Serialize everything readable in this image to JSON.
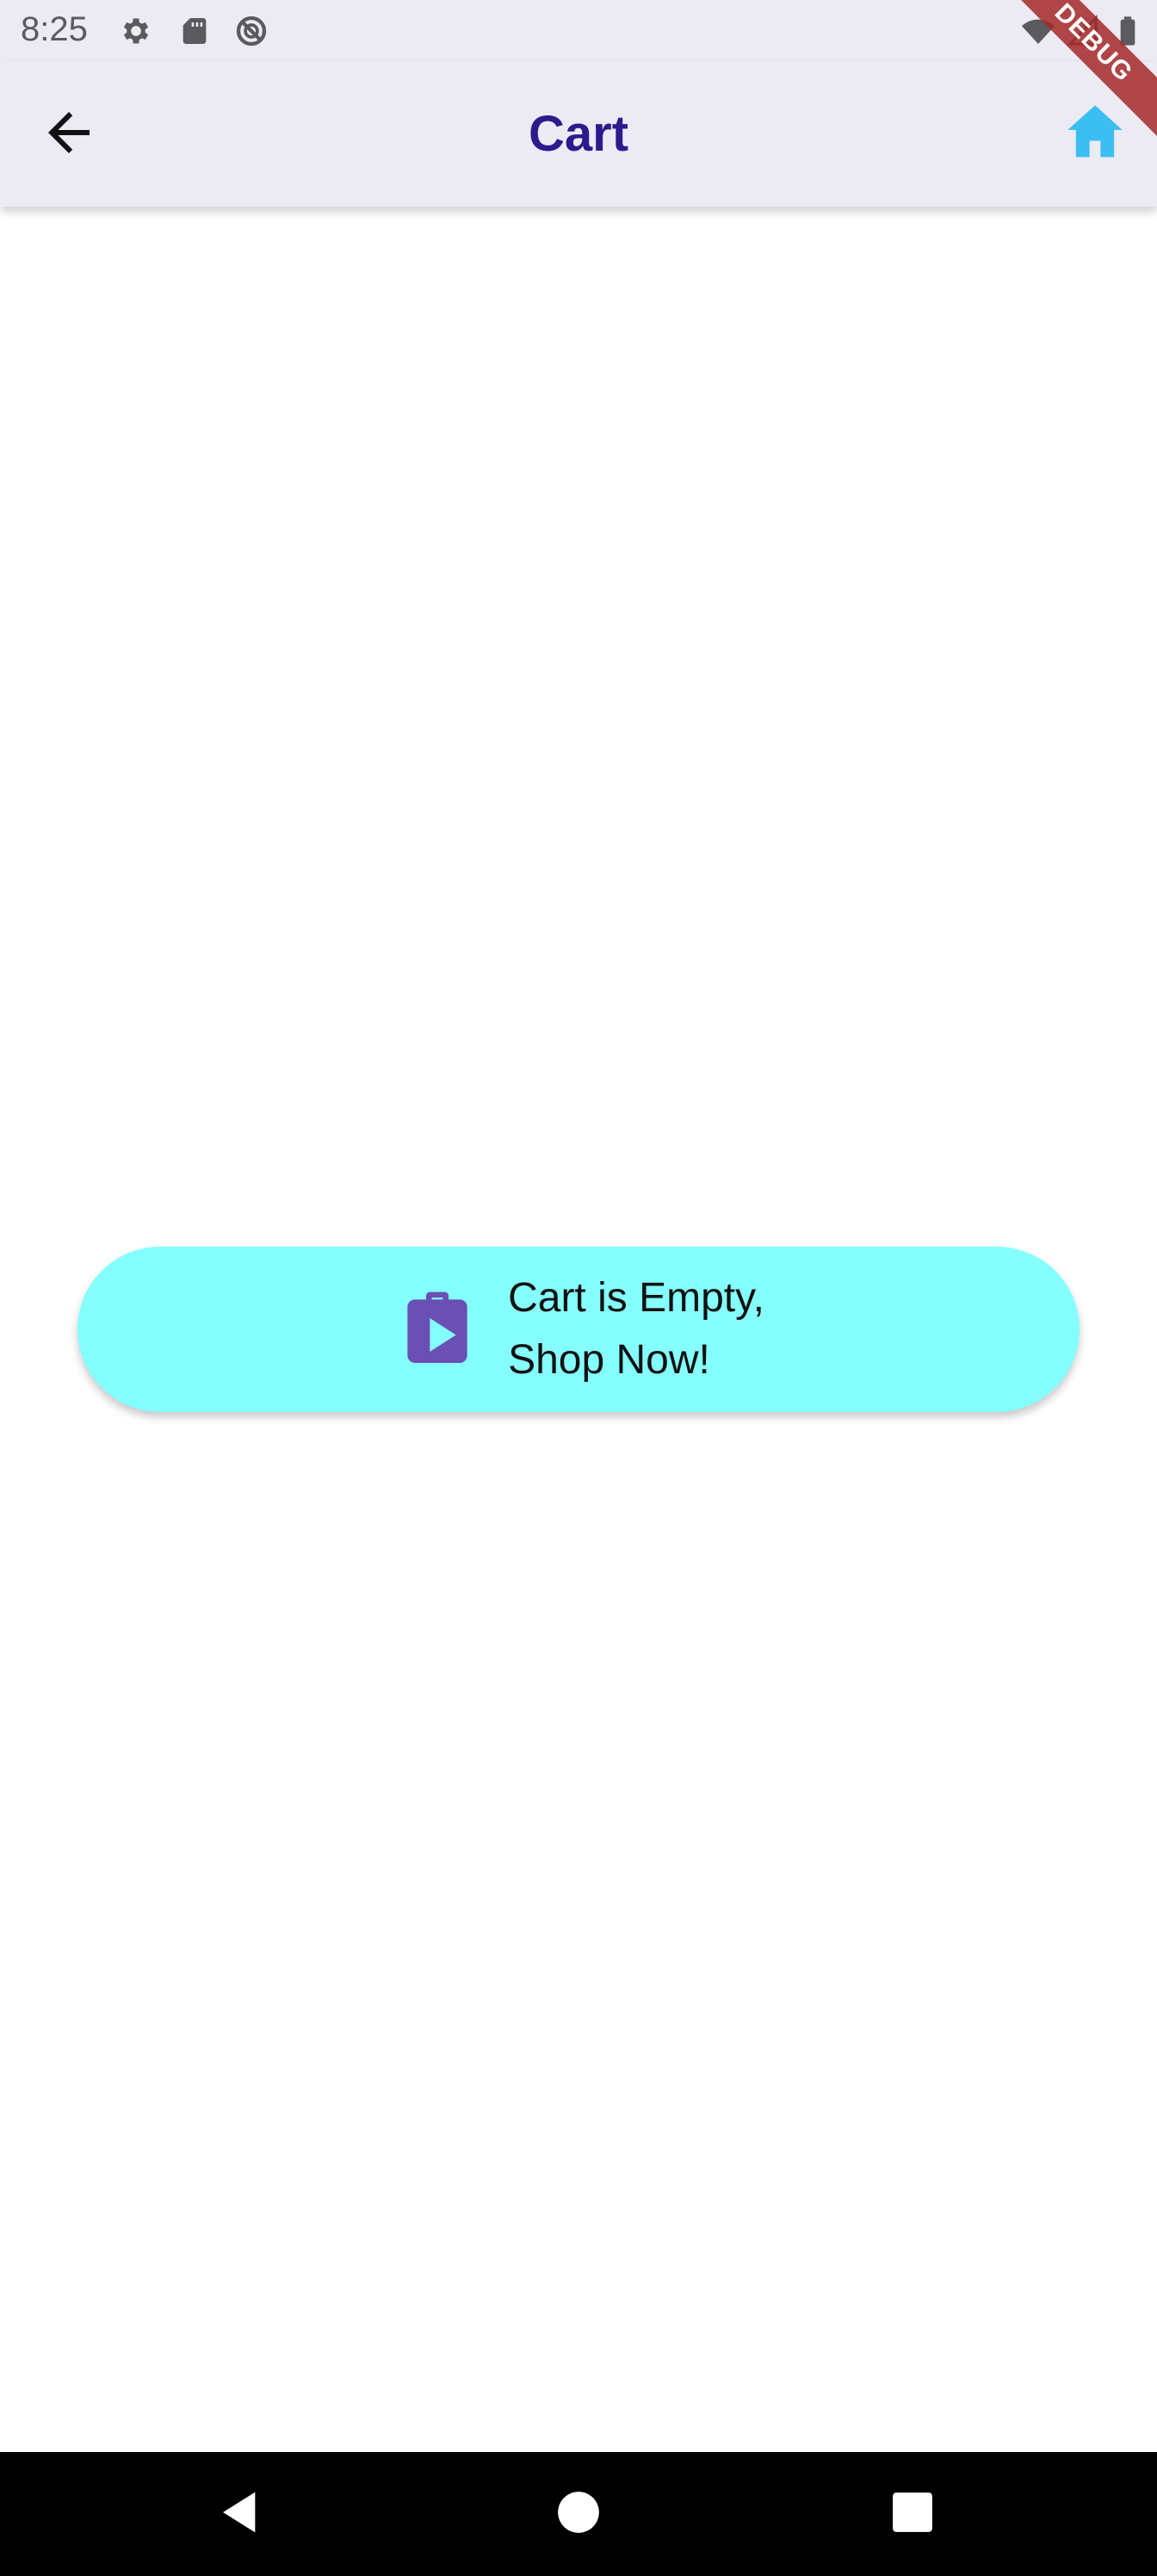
{
  "status_bar": {
    "time": "8:25",
    "icons": [
      "gear-icon",
      "sd-card-icon",
      "no-disturb-icon",
      "wifi-icon",
      "signal-icon",
      "battery-icon"
    ]
  },
  "app_bar": {
    "title": "Cart",
    "back_icon": "arrow-back-icon",
    "home_icon": "home-icon",
    "title_color": "#2d1a8c",
    "home_icon_color": "#3cbef0"
  },
  "debug_banner": {
    "label": "DEBUG"
  },
  "main": {
    "empty_cart_button": {
      "label": "Cart is Empty,\nShop Now!",
      "icon": "shop-icon",
      "background_color": "#85fffe",
      "icon_color": "#6a4fb5"
    }
  },
  "nav_bar": {
    "buttons": [
      "back-triangle-icon",
      "home-circle-icon",
      "recents-square-icon"
    ]
  }
}
